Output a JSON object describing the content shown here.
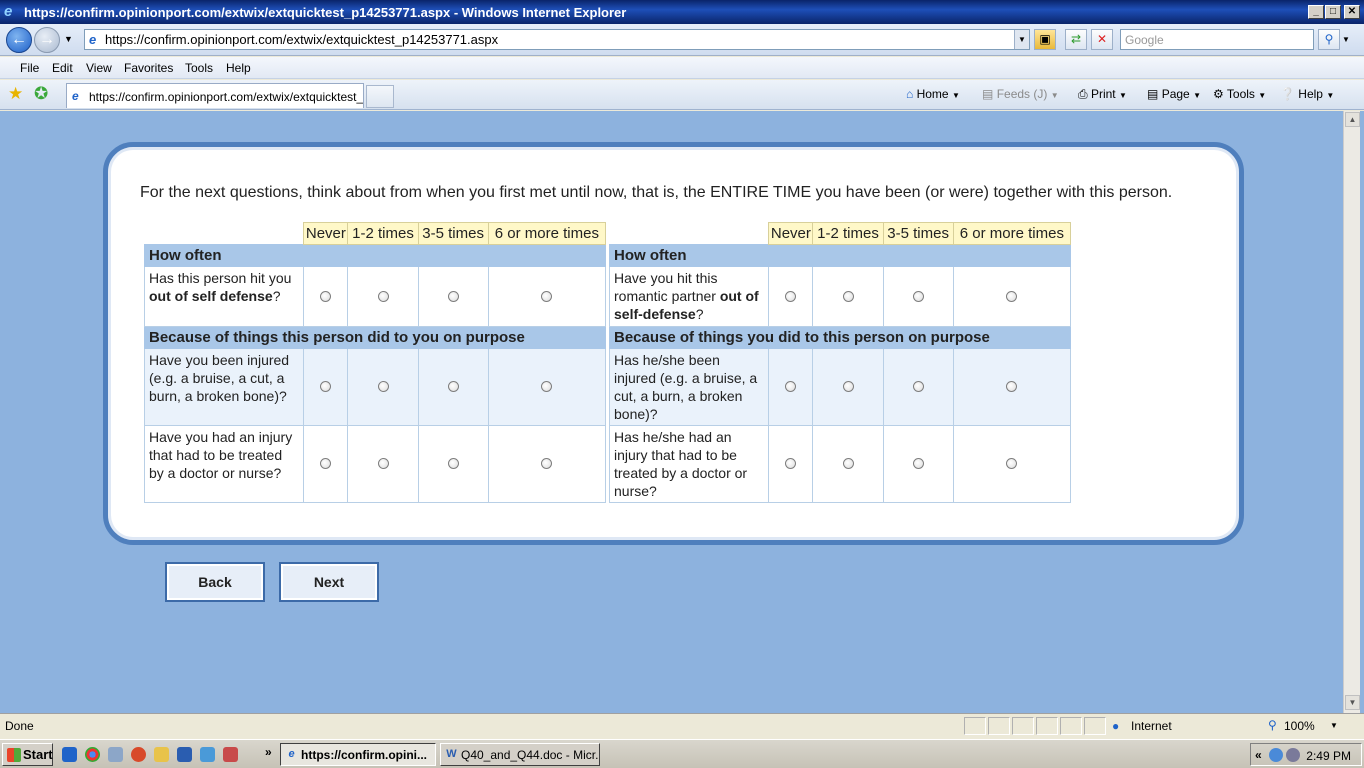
{
  "window": {
    "title": "https://confirm.opinionport.com/extwix/extquicktest_p14253771.aspx - Windows Internet Explorer",
    "buttons": {
      "minimize": "_",
      "maximize": "□",
      "close": "✕"
    }
  },
  "address": {
    "url": "https://confirm.opinionport.com/extwix/extquicktest_p14253771.aspx",
    "search_placeholder": "Google"
  },
  "menu": [
    "File",
    "Edit",
    "View",
    "Favorites",
    "Tools",
    "Help"
  ],
  "tab": {
    "label": "https://confirm.opinionport.com/extwix/extquicktest_..."
  },
  "commands": {
    "home": "Home",
    "feeds": "Feeds (J)",
    "print": "Print",
    "page": "Page",
    "tools": "Tools",
    "help": "Help"
  },
  "survey": {
    "intro": "For the next questions, think about from when you first met until now, that is, the ENTIRE TIME you have been (or were) together with this person.",
    "columns": [
      "Never",
      "1-2 times",
      "3-5 times",
      "6 or more times"
    ],
    "left": {
      "section1": "How often",
      "q1": {
        "a": "Has this person hit you ",
        "b": "out of self defense",
        "c": "?"
      },
      "section2": "Because of things this person did to you on purpose",
      "q2": "Have you been injured (e.g. a bruise, a cut, a burn, a broken bone)?",
      "q3": "Have you had an injury that had to be treated by a doctor or nurse?"
    },
    "right": {
      "section1": "How often",
      "q1": {
        "a": "Have you hit this romantic partner ",
        "b": "out of self-defense",
        "c": "?"
      },
      "section2": "Because of things you did to this person on purpose",
      "q2": "Has he/she been injured (e.g. a bruise, a cut, a burn, a broken bone)?",
      "q3": "Has he/she had an injury that had to be treated by a doctor or nurse?"
    },
    "back_label": "Back",
    "next_label": "Next"
  },
  "status": {
    "text": "Done",
    "zone": "Internet",
    "zoom": "100%"
  },
  "taskbar": {
    "start": "Start",
    "tasks": [
      "https://confirm.opini...",
      "Q40_and_Q44.doc - Micr..."
    ],
    "clock": "2:49 PM",
    "overflow": "»"
  },
  "colors": {
    "page_bg": "#8db2de",
    "panel_border": "#4f7fbd",
    "header_bg": "#a9c7e8",
    "column_bg": "#fff8c8"
  }
}
